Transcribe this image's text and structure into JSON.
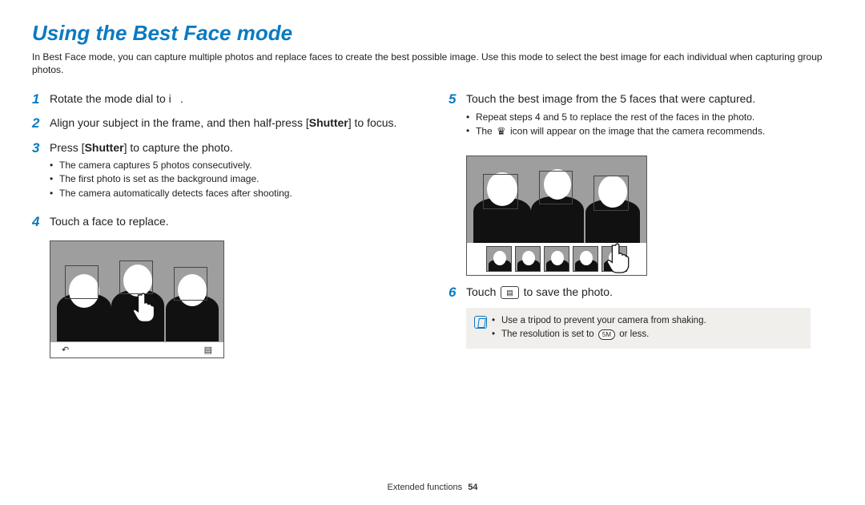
{
  "title": "Using the Best Face mode",
  "intro": "In Best Face mode, you can capture multiple photos and replace faces to create the best possible image. Use this mode to select the best image for each individual when capturing group photos.",
  "left": {
    "s1": {
      "num": "1",
      "text": "Rotate the mode dial to i    ."
    },
    "s2": {
      "num": "2",
      "text_a": "Align your subject in the frame, and then half-press [",
      "text_b": "Shutter",
      "text_c": "] to focus."
    },
    "s3": {
      "num": "3",
      "text_a": "Press [",
      "text_b": "Shutter",
      "text_c": "] to capture the photo."
    },
    "s3b": [
      "The camera captures 5 photos consecutively.",
      "The first photo is set as the background image.",
      "The camera automatically detects faces after shooting."
    ],
    "s4": {
      "num": "4",
      "text": "Touch a face to replace."
    }
  },
  "right": {
    "s5": {
      "num": "5",
      "text": "Touch the best image from the 5 faces that were captured."
    },
    "s5b_a": "Repeat steps 4 and 5 to replace the rest of the faces in the photo.",
    "s5b_b_a": "The ",
    "s5b_b_b": " icon will appear on the image that the camera recommends.",
    "s6": {
      "num": "6",
      "text_a": "Touch ",
      "text_b": " to save the photo."
    }
  },
  "note": {
    "l1": "Use a tripod to prevent your camera from shaking.",
    "l2_a": "The resolution is set to ",
    "l2_pill": "5M",
    "l2_b": " or less."
  },
  "footer": {
    "section": "Extended functions",
    "page": "54"
  },
  "icons": {
    "crown": "♛",
    "save": "▤",
    "back": "↶"
  }
}
